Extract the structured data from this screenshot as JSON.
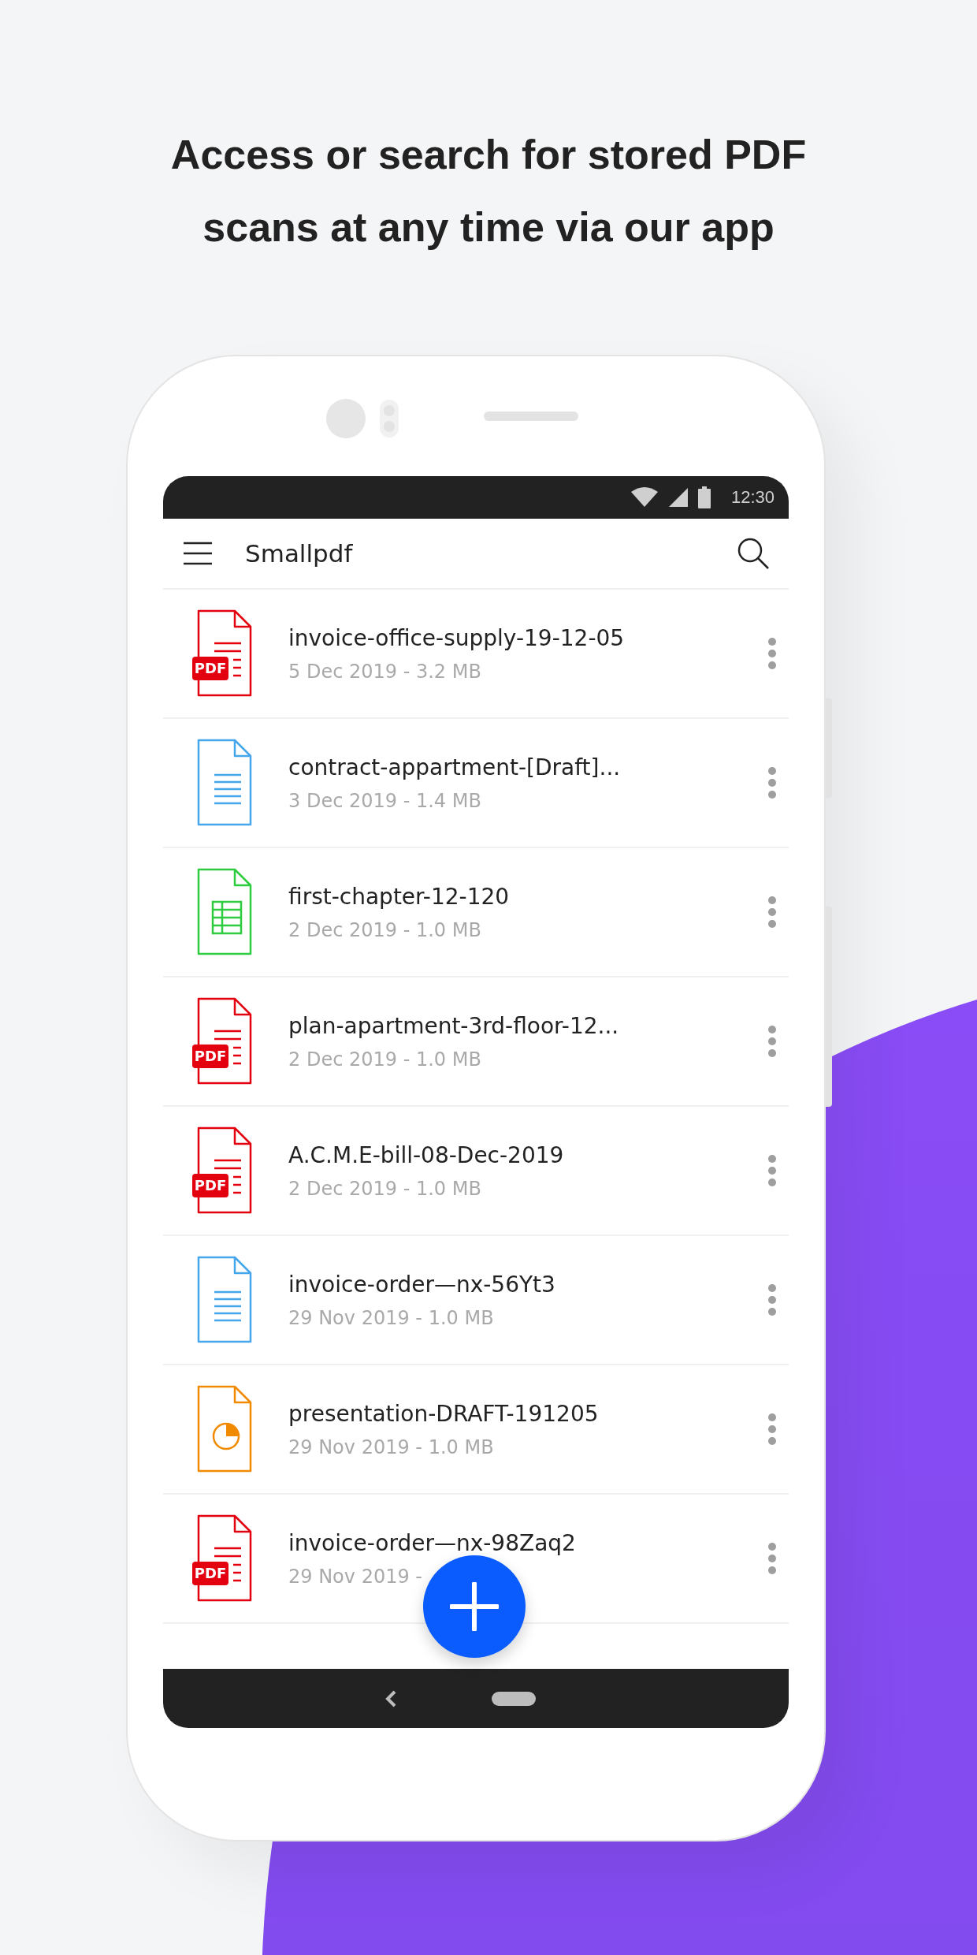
{
  "headline": "Access or search for stored PDF scans at any time via our app",
  "status_bar": {
    "time": "12:30"
  },
  "app_bar": {
    "title": "Smallpdf"
  },
  "files": [
    {
      "kind": "pdf",
      "name": "invoice-office-supply-19-12-05",
      "meta": "5 Dec 2019 - 3.2 MB",
      "badge": "PDF"
    },
    {
      "kind": "doc",
      "name": "contract-appartment-[Draft]...",
      "meta": "3 Dec 2019 - 1.4 MB"
    },
    {
      "kind": "sheet",
      "name": "first-chapter-12-120",
      "meta": "2 Dec 2019 - 1.0 MB"
    },
    {
      "kind": "pdf",
      "name": "plan-apartment-3rd-floor-12...",
      "meta": "2 Dec 2019 - 1.0 MB",
      "badge": "PDF"
    },
    {
      "kind": "pdf",
      "name": "A.C.M.E-bill-08-Dec-2019",
      "meta": "2 Dec 2019 - 1.0 MB",
      "badge": "PDF"
    },
    {
      "kind": "doc",
      "name": "invoice-order—nx-56Yt3",
      "meta": "29 Nov 2019 - 1.0 MB"
    },
    {
      "kind": "slides",
      "name": "presentation-DRAFT-191205",
      "meta": "29 Nov 2019 - 1.0 MB"
    },
    {
      "kind": "pdf",
      "name": "invoice-order—nx-98Zaq2",
      "meta": "29 Nov 2019 -",
      "badge": "PDF"
    }
  ]
}
